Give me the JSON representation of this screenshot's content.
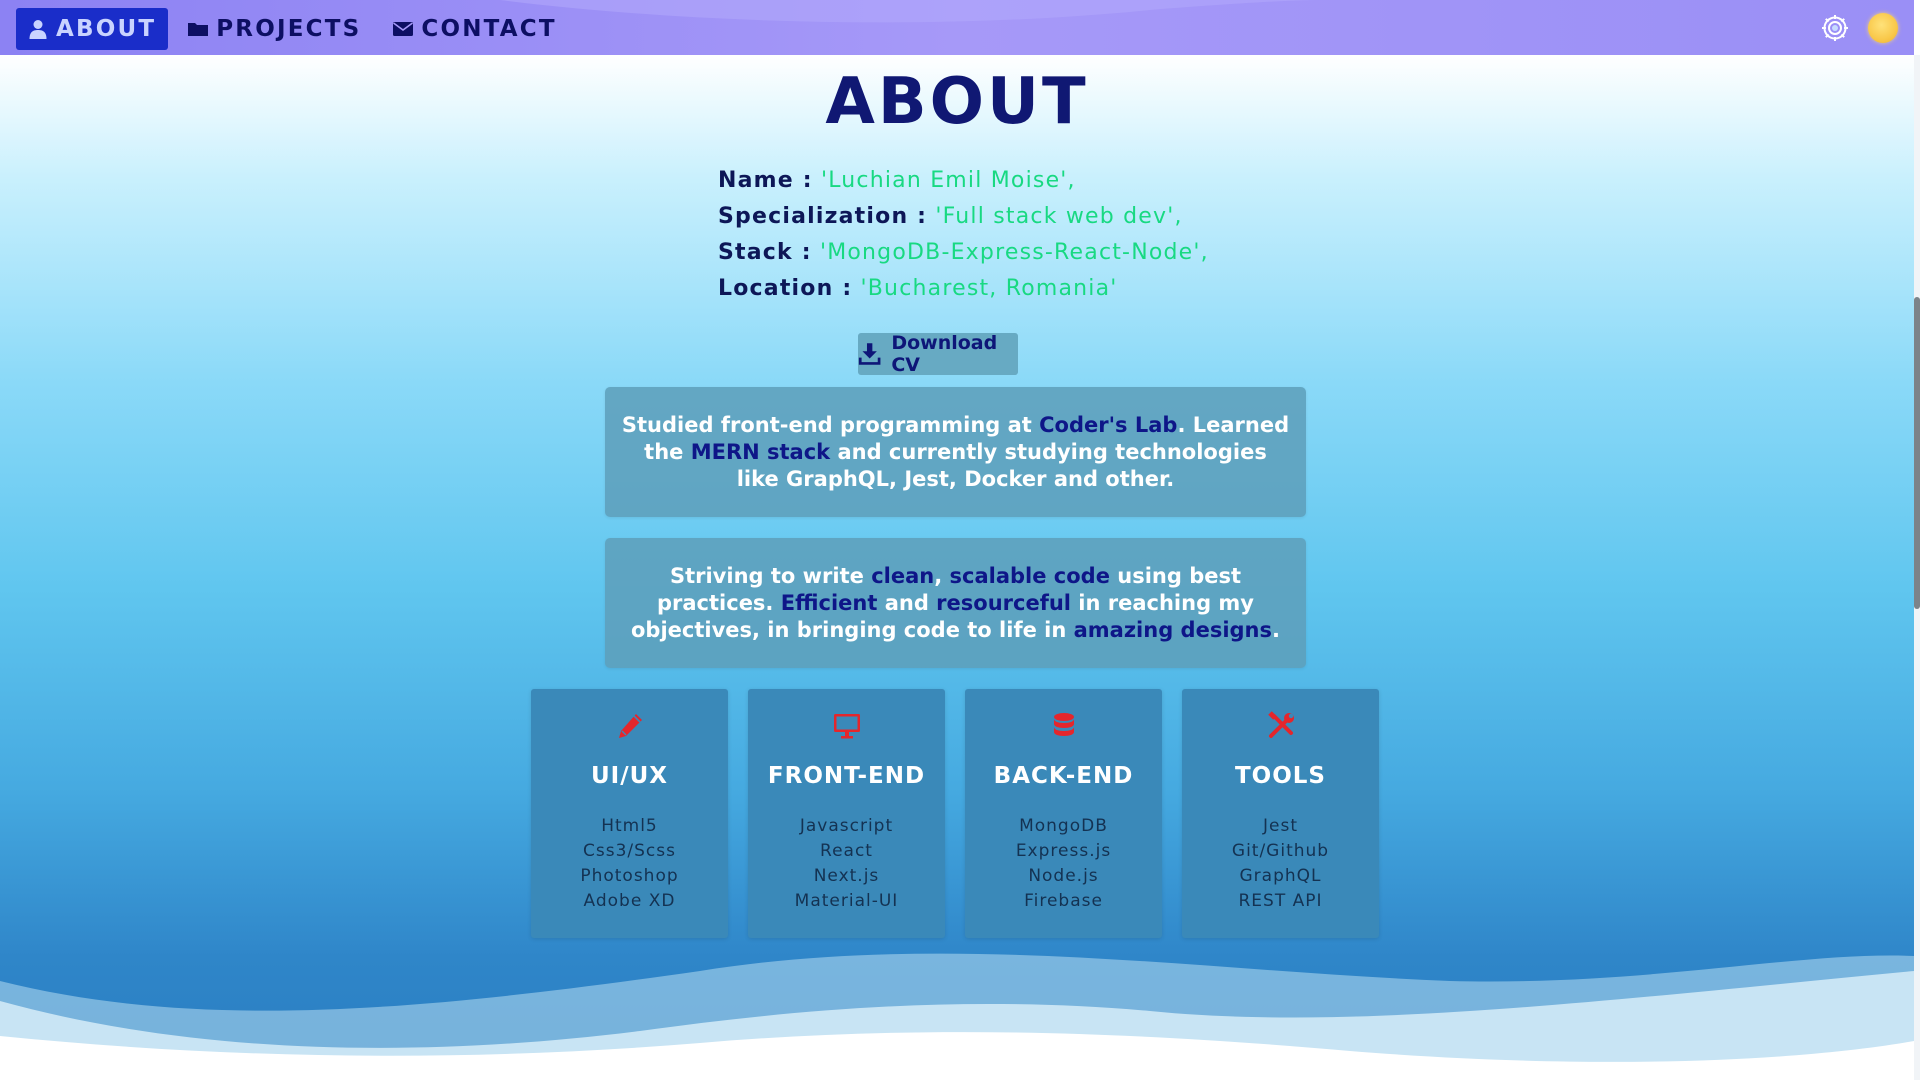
{
  "nav": {
    "items": [
      {
        "label": "ABOUT",
        "icon": "user-icon",
        "active": true
      },
      {
        "label": "PROJECTS",
        "icon": "folder-icon",
        "active": false
      },
      {
        "label": "CONTACT",
        "icon": "envelope-icon",
        "active": false
      }
    ],
    "settings_icon": "gear-icon",
    "theme_icon": "sun-icon"
  },
  "page": {
    "title": "ABOUT"
  },
  "info": {
    "rows": [
      {
        "key": "Name :",
        "value": "'Luchian Emil Moise',"
      },
      {
        "key": "Specialization :",
        "value": "'Full stack web dev',"
      },
      {
        "key": "Stack :",
        "value": "'MongoDB-Express-React-Node',"
      },
      {
        "key": "Location :",
        "value": "'Bucharest, Romania'"
      }
    ]
  },
  "download": {
    "label": "Download CV",
    "icon": "download-icon"
  },
  "panels": {
    "studied": {
      "t1": "Studied front-end programming at ",
      "h1": "Coder's Lab",
      "t2": ". Learned the ",
      "h2": "MERN stack",
      "t3": " and currently studying technologies like GraphQL, Jest, Docker and other."
    },
    "striving": {
      "t1": "Striving to write ",
      "h1": "clean",
      "t2": ", ",
      "h2": "scalable code",
      "t3": " using best practices. ",
      "h3": "Efficient",
      "t4": " and ",
      "h4": "resourceful",
      "t5": " in reaching my objectives, in bringing code to life in ",
      "h5": "amazing designs",
      "t6": "."
    }
  },
  "cards": [
    {
      "title": "UI/UX",
      "icon": "pencil-icon",
      "items": [
        "Html5",
        "Css3/Scss",
        "Photoshop",
        "Adobe XD"
      ]
    },
    {
      "title": "FRONT-END",
      "icon": "monitor-icon",
      "items": [
        "Javascript",
        "React",
        "Next.js",
        "Material-UI"
      ]
    },
    {
      "title": "BACK-END",
      "icon": "database-icon",
      "items": [
        "MongoDB",
        "Express.js",
        "Node.js",
        "Firebase"
      ]
    },
    {
      "title": "TOOLS",
      "icon": "tools-icon",
      "items": [
        "Jest",
        "Git/Github",
        "GraphQL",
        "REST API"
      ]
    }
  ],
  "colors": {
    "nav_bg": "#9a8ff6",
    "nav_active": "#1a2dc9",
    "title": "#101873",
    "info_key": "#0d1757",
    "info_value": "#18d982",
    "highlight": "#0e1688",
    "card_bg": "#3a89b9",
    "card_icon": "#e4262c"
  }
}
